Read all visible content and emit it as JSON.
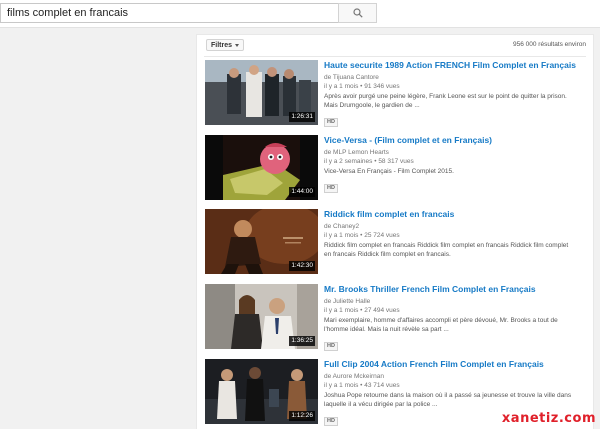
{
  "search": {
    "query": "films complet en francais"
  },
  "toolbar": {
    "filter_label": "Filtres",
    "result_count": "956 000 résultats environ"
  },
  "results": [
    {
      "title": "Haute securite 1989 Action FRENCH Film Complet en Français",
      "channel": "de Tijuana Cantore",
      "age": "il y a 1 mois",
      "views": "91 346 vues",
      "description_lines": [
        "Après avoir purgé une peine légère, Frank Leone est sur le point de quitter la prison.",
        "Mais Drumgoole, le gardien de ..."
      ],
      "duration": "1:26:31",
      "badge": "HD"
    },
    {
      "title": "Vice-Versa - (Film complet et en Français)",
      "channel": "de MLP Lemon Hearts",
      "age": "il y a 2 semaines",
      "views": "58 317 vues",
      "description_lines": [
        "Vice-Versa En Français - Film Complet 2015."
      ],
      "duration": "1:44:00",
      "badge": "HD"
    },
    {
      "title": "Riddick film complet en francais",
      "channel": "de Chaney2",
      "age": "il y a 1 mois",
      "views": "25 724 vues",
      "description_lines": [
        "Riddick film complet en francais Riddick film complet en francais Riddick film complet",
        "en francais Riddick film complet en francais."
      ],
      "duration": "1:42:30",
      "badge": ""
    },
    {
      "title": "Mr. Brooks Thriller French Film Complet en Français",
      "channel": "de Juliette Halle",
      "age": "il y a 1 mois",
      "views": "27 494 vues",
      "description_lines": [
        "Mari exemplaire, homme d'affaires accompli et père dévoué, Mr. Brooks a tout de",
        "l'homme idéal. Mais la nuit révèle sa part ..."
      ],
      "duration": "1:36:25",
      "badge": "HD"
    },
    {
      "title": "Full Clip 2004 Action French Film Complet en Français",
      "channel": "de Aurore Mckeirnan",
      "age": "il y a 1 mois",
      "views": "43 714 vues",
      "description_lines": [
        "Joshua Pope retourne dans la maison où il a passé sa jeunesse et trouve la ville dans",
        "laquelle il a vécu dirigée par la police ..."
      ],
      "duration": "1:12:26",
      "badge": "HD"
    }
  ],
  "watermark": "xanetiz.com",
  "colors": {
    "link": "#167ac6",
    "meta": "#767676",
    "watermark": "#e0202a",
    "page_bg": "#f1f1f1"
  }
}
